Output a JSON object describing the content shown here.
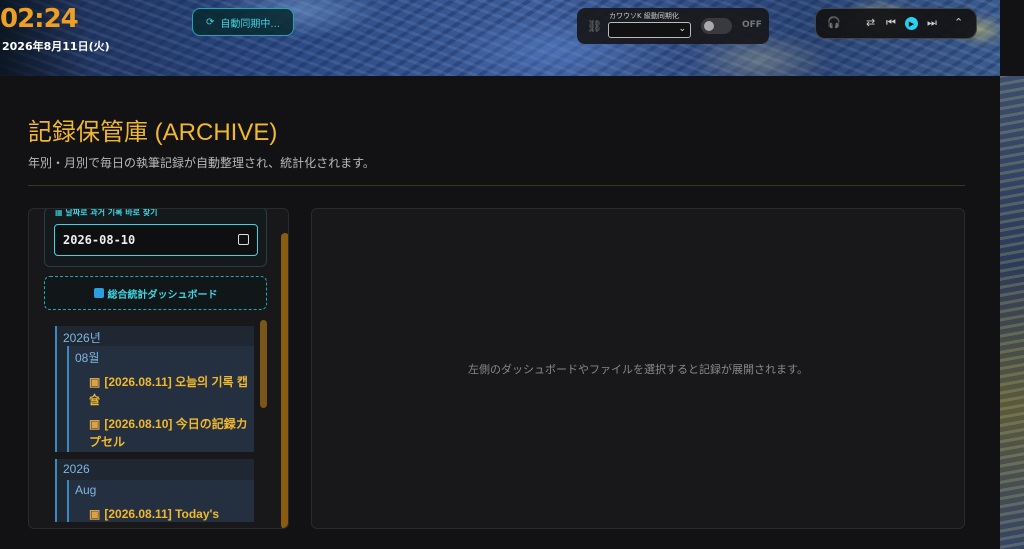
{
  "header": {
    "clock": "02:24",
    "date": "2026年8月11日(火)",
    "sync_label": "自動同期中...",
    "kakao_label": "カワウソK 級動同期化",
    "kakao_select_value": "",
    "toggle_state": "OFF"
  },
  "page": {
    "title": "記録保管庫 (ARCHIVE)",
    "subtitle": "年別・月別で毎日の執筆記録が自動整理され、統計化されます。"
  },
  "sidebar": {
    "date_label": "날짜로 과거 기록 바로 찾기",
    "date_value": "2026-08-10",
    "dashboard_button": "総合統計ダッシュボード",
    "tree": [
      {
        "year": "2026년",
        "months": [
          {
            "month": "08월",
            "entries": [
              "[2026.08.11] 오늘의 기록 캡슐",
              "[2026.08.10] 今日の記録カプセル"
            ]
          }
        ]
      },
      {
        "year": "2026",
        "months": [
          {
            "month": "Aug",
            "entries": [
              "[2026.08.11] Today's"
            ]
          }
        ]
      }
    ]
  },
  "main": {
    "placeholder": "左側のダッシュボードやファイルを選択すると記録が展開されます。"
  },
  "colors": {
    "accent": "#f1b82d",
    "cyan": "#3fd3e0",
    "background": "#121214"
  }
}
